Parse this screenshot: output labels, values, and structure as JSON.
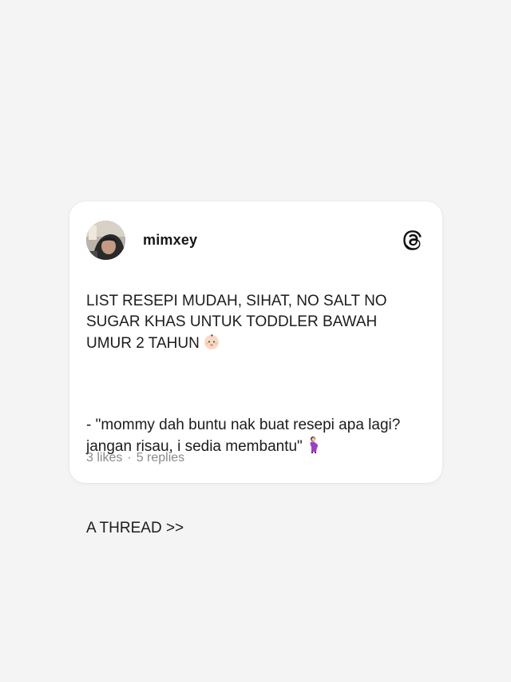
{
  "post": {
    "username": "mimxey",
    "paragraphs": {
      "p1": "LIST RESEPI MUDAH, SIHAT, NO SALT NO SUGAR KHAS UNTUK TODDLER BAWAH UMUR 2 TAHUN",
      "p2": "- \"mommy dah buntu nak buat resepi apa lagi? jangan risau, i sedia membantu\"",
      "p3": "A THREAD >>"
    },
    "emoji": {
      "p1": "baby-face",
      "p2": "pregnant-woman"
    },
    "likes": "3 likes",
    "separator": "·",
    "replies": "5 replies"
  },
  "icons": {
    "avatar": "profile-photo",
    "logo": "threads-logo-icon"
  },
  "colors": {
    "background": "#f4f4f4",
    "card": "#ffffff",
    "text": "#1c1c1c",
    "muted": "#8a8a8a"
  }
}
